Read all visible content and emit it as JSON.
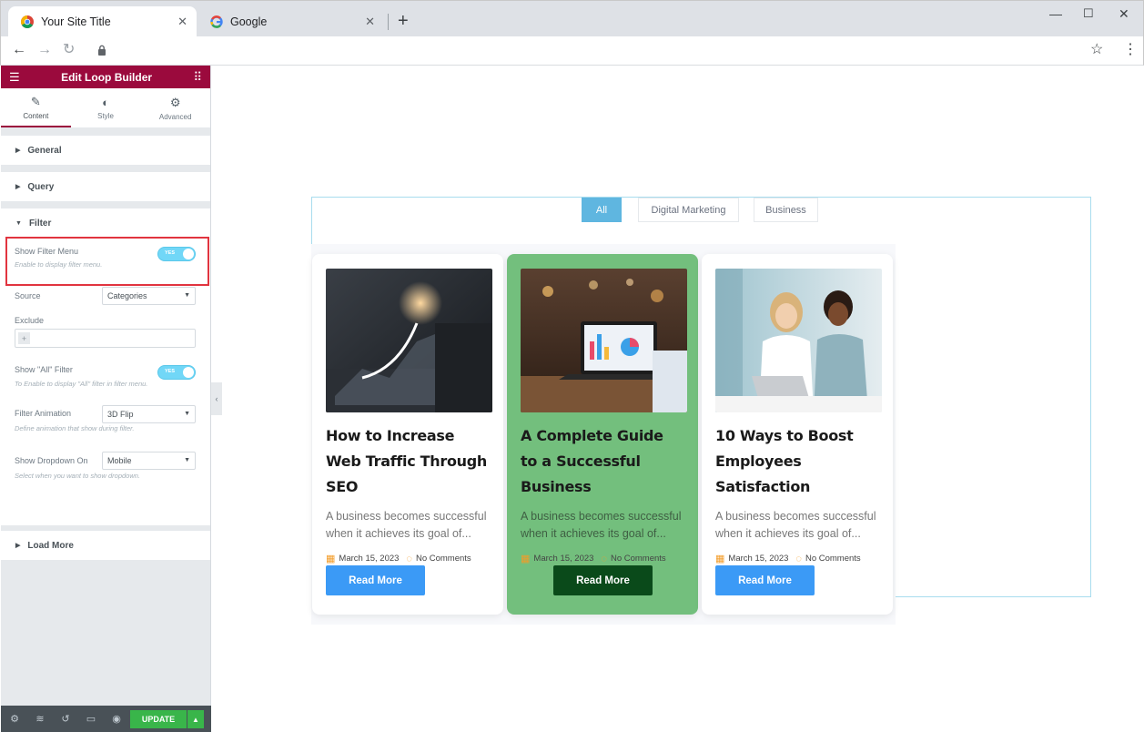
{
  "browser": {
    "tabs": [
      {
        "title": "Your Site Title",
        "active": true,
        "icon": "chrome-icon"
      },
      {
        "title": "Google",
        "active": false,
        "icon": "google-icon"
      }
    ]
  },
  "panel": {
    "title": "Edit Loop Builder",
    "tabs": [
      {
        "label": "Content",
        "icon": "pencil-icon",
        "active": true
      },
      {
        "label": "Style",
        "icon": "contrast-icon",
        "active": false
      },
      {
        "label": "Advanced",
        "icon": "gear-icon",
        "active": false
      }
    ],
    "sections": {
      "general": "General",
      "query": "Query",
      "filter": "Filter",
      "load_more": "Load More"
    },
    "filter": {
      "show_filter_menu": {
        "label": "Show Filter Menu",
        "desc": "Enable to display filter menu.",
        "toggle": "YES"
      },
      "source": {
        "label": "Source",
        "value": "Categories"
      },
      "exclude": {
        "label": "Exclude",
        "add": "+"
      },
      "show_all": {
        "label": "Show \"All\" Filter",
        "desc": "To Enable to display \"All\" filter in filter menu.",
        "toggle": "YES"
      },
      "animation": {
        "label": "Filter Animation",
        "value": "3D Flip",
        "desc": "Define animation that show during filter."
      },
      "dropdown": {
        "label": "Show Dropdown On",
        "value": "Mobile",
        "desc": "Select when you want to show dropdown."
      }
    },
    "footer": {
      "update": "UPDATE"
    }
  },
  "filters": [
    "All",
    "Digital Marketing",
    "Business"
  ],
  "active_filter": "All",
  "cards": [
    {
      "title": "How to Increase Web Traffic Through SEO",
      "excerpt": "A business becomes successful when it achieves its goal of...",
      "date": "March 15, 2023",
      "comments": "No Comments",
      "button": "Read More",
      "image": "laptop-growth-chart-photo"
    },
    {
      "title": "A Complete Guide to a Successful Business",
      "excerpt": "A business becomes successful when it achieves its goal of...",
      "date": "March 15, 2023",
      "comments": "No Comments",
      "button": "Read More",
      "image": "laptop-analytics-dashboard-photo"
    },
    {
      "title": "10 Ways to Boost Employees Satisfaction",
      "excerpt": "A business becomes successful when it achieves its goal of...",
      "date": "March 15, 2023",
      "comments": "No Comments",
      "button": "Read More",
      "image": "coworkers-laptop-photo"
    }
  ],
  "colors": {
    "panel_header": "#9b0a3d",
    "filter_active": "#5fb6e0",
    "read_more": "#3b9af6",
    "read_more_featured": "#0a4a1a",
    "featured_card": "#73bf7d",
    "highlight": "#e1343f"
  }
}
